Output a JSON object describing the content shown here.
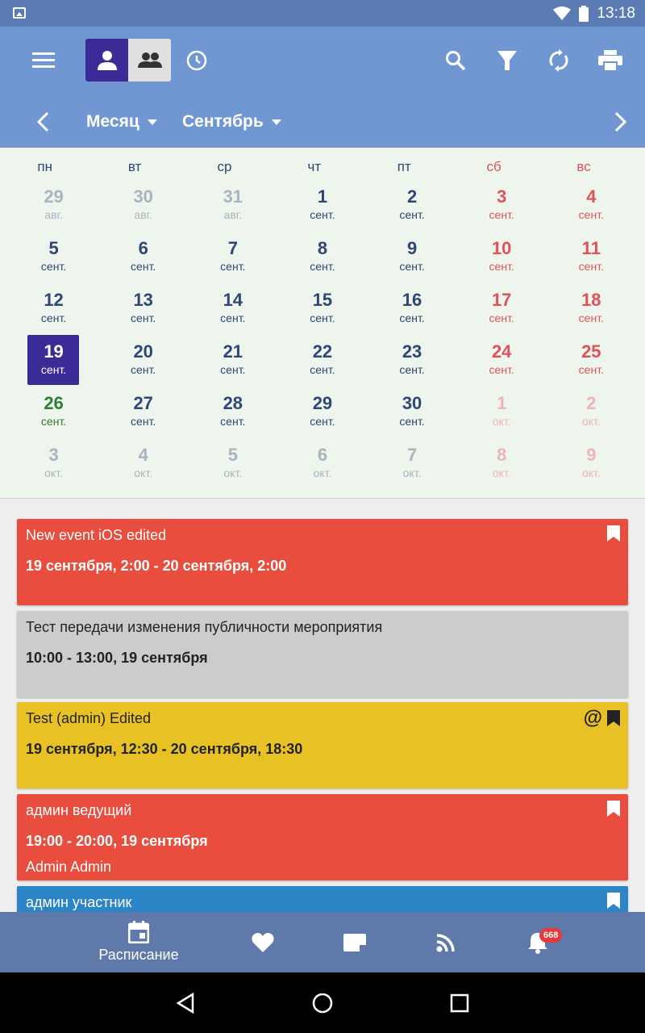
{
  "status_bar": {
    "time": "13:18"
  },
  "toolbar": {
    "view_mode": "Месяц",
    "month": "Сентябрь"
  },
  "calendar": {
    "weekdays": [
      "пн",
      "вт",
      "ср",
      "чт",
      "пт",
      "сб",
      "вс"
    ],
    "weeks": [
      [
        [
          "29",
          "авг."
        ],
        [
          "30",
          "авг."
        ],
        [
          "31",
          "авг."
        ],
        [
          "1",
          "сент."
        ],
        [
          "2",
          "сент."
        ],
        [
          "3",
          "сент."
        ],
        [
          "4",
          "сент."
        ]
      ],
      [
        [
          "5",
          "сент."
        ],
        [
          "6",
          "сент."
        ],
        [
          "7",
          "сент."
        ],
        [
          "8",
          "сент."
        ],
        [
          "9",
          "сент."
        ],
        [
          "10",
          "сент."
        ],
        [
          "11",
          "сент."
        ]
      ],
      [
        [
          "12",
          "сент."
        ],
        [
          "13",
          "сент."
        ],
        [
          "14",
          "сент."
        ],
        [
          "15",
          "сент."
        ],
        [
          "16",
          "сент."
        ],
        [
          "17",
          "сент."
        ],
        [
          "18",
          "сент."
        ]
      ],
      [
        [
          "19",
          "сент."
        ],
        [
          "20",
          "сент."
        ],
        [
          "21",
          "сент."
        ],
        [
          "22",
          "сент."
        ],
        [
          "23",
          "сент."
        ],
        [
          "24",
          "сент."
        ],
        [
          "25",
          "сент."
        ]
      ],
      [
        [
          "26",
          "сент."
        ],
        [
          "27",
          "сент."
        ],
        [
          "28",
          "сент."
        ],
        [
          "29",
          "сент."
        ],
        [
          "30",
          "сент."
        ],
        [
          "1",
          "окт."
        ],
        [
          "2",
          "окт."
        ]
      ],
      [
        [
          "3",
          "окт."
        ],
        [
          "4",
          "окт."
        ],
        [
          "5",
          "окт."
        ],
        [
          "6",
          "окт."
        ],
        [
          "7",
          "окт."
        ],
        [
          "8",
          "окт."
        ],
        [
          "9",
          "окт."
        ]
      ]
    ]
  },
  "events": [
    {
      "title": "New event iOS edited",
      "time": "19 сентября, 2:00 - 20 сентября, 2:00",
      "color": "#e84d3d"
    },
    {
      "title": "Тест передачи изменения публичности мероприятия",
      "time": "10:00 - 13:00, 19 сентября",
      "color": "#cccccc"
    },
    {
      "title": "Test (admin) Edited",
      "time": "19 сентября, 12:30 - 20 сентября, 18:30",
      "mention": "@",
      "color": "#e8c224"
    },
    {
      "title": "админ ведущий",
      "time": "19:00 - 20:00, 19 сентября",
      "person": "Admin Admin",
      "color": "#e84d3d"
    },
    {
      "title": "админ участник",
      "color": "#2c85c6"
    }
  ],
  "bottom_nav": {
    "schedule_label": "Расписание",
    "notification_count": "668"
  },
  "colors": {
    "app_bar": "#7197d2",
    "selected": "#3b2b96",
    "weekend": "#e0525a",
    "today": "#2e7d32"
  }
}
